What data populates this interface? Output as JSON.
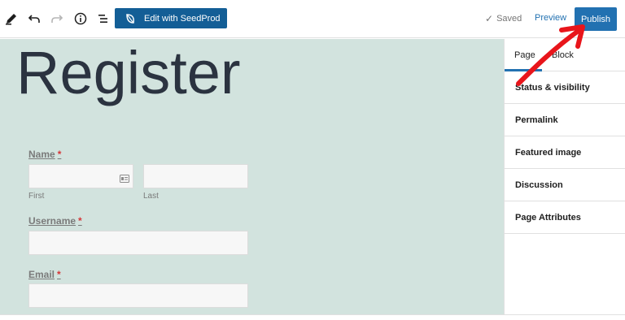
{
  "toolbar": {
    "seedprod_label": "Edit with SeedProd",
    "saved_label": "Saved",
    "preview_label": "Preview",
    "publish_label": "Publish",
    "accent_color": "#2271b1",
    "seedprod_color": "#135e96"
  },
  "icons": [
    "pencil-icon",
    "undo-icon",
    "redo-icon",
    "info-icon",
    "list-view-icon",
    "seedprod-logo-icon",
    "check-icon",
    "card-icon"
  ],
  "page": {
    "title": "Register",
    "background": "#d2e3de",
    "form": {
      "name_label": "Name",
      "name_first_sublabel": "First",
      "name_last_sublabel": "Last",
      "username_label": "Username",
      "email_label": "Email",
      "required_mark": "*"
    }
  },
  "sidebar": {
    "tabs": [
      {
        "label": "Page",
        "active": true
      },
      {
        "label": "Block",
        "active": false
      }
    ],
    "panels": [
      {
        "label": "Status & visibility"
      },
      {
        "label": "Permalink"
      },
      {
        "label": "Featured image"
      },
      {
        "label": "Discussion"
      },
      {
        "label": "Page Attributes"
      }
    ]
  },
  "annotation": {
    "color": "#e8151b",
    "points_to": "Publish"
  }
}
